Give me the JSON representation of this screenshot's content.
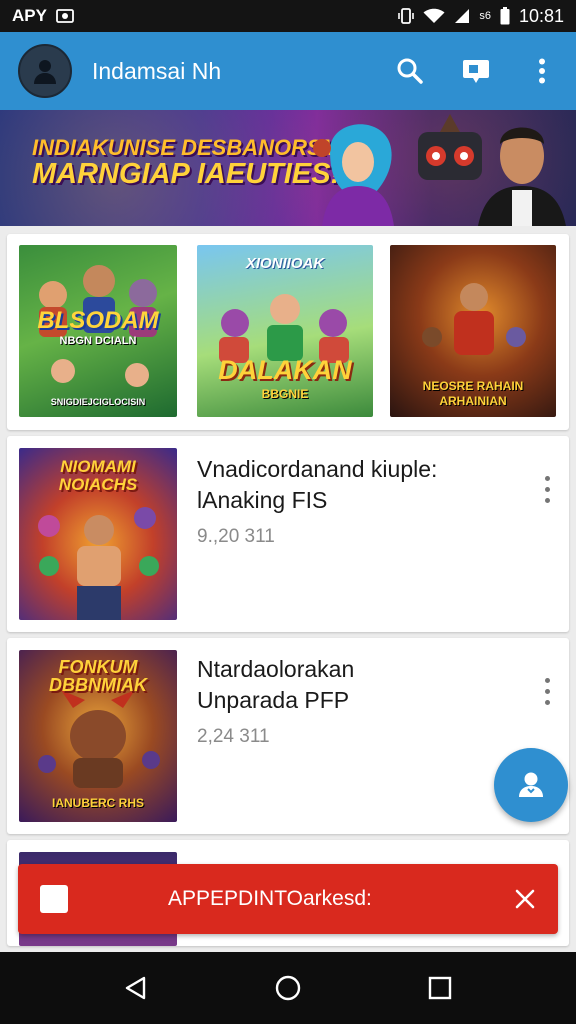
{
  "status_bar": {
    "carrier": "APY",
    "time": "10:81",
    "signal_label": "s6"
  },
  "app_bar": {
    "title": "Indamsai Nh",
    "avatar_icon": "person-icon",
    "actions": [
      "search-icon",
      "cast-icon",
      "more-vert-icon"
    ]
  },
  "banner": {
    "line1": "INDIAKUNISE DESBANORSM",
    "line2": "MARNGIAP IAEUTIES!"
  },
  "grid": {
    "tiles": [
      {
        "title": "BLSODAM",
        "subtitle": "NBGN DCIALN",
        "caption": "SNIGDIEJCIGLOCISIN"
      },
      {
        "title": "DALAKAN",
        "subtitle": "XIONIIOAK",
        "caption": "BBGNIE"
      },
      {
        "title": "",
        "subtitle": "",
        "caption": "NEOSRE RAHAIN ARHAINIAN"
      }
    ]
  },
  "list": {
    "items": [
      {
        "title_line1": "Vnadicordanand kiuple:",
        "title_line2": "lAnaking FIS",
        "meta": "9.,20 311",
        "thumb_title": "NIOMAMI NOIACHS"
      },
      {
        "title_line1": "Ntardaolorakan",
        "title_line2": "Unparada PFP",
        "meta": "2,24 311",
        "thumb_title": "FONKUM DBBNMIAK",
        "thumb_caption": "IANUBERC RHS"
      }
    ]
  },
  "fab": {
    "icon": "download-user-icon"
  },
  "snackbar": {
    "message": "APPEPDINTOarkesd:"
  },
  "nav": {
    "buttons": [
      "back-icon",
      "home-icon",
      "recents-icon"
    ]
  },
  "colors": {
    "app_bar": "#2f8fd0",
    "snackbar": "#d9291e",
    "background": "#ececec"
  }
}
